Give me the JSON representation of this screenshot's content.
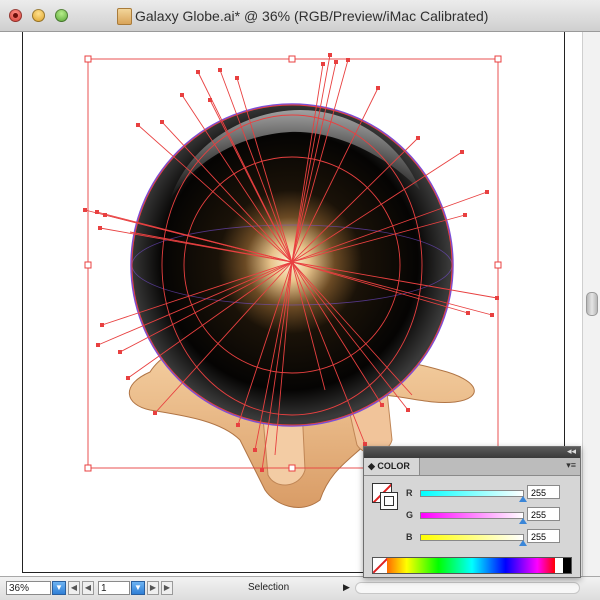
{
  "window": {
    "title": "Galaxy Globe.ai* @ 36% (RGB/Preview/iMac Calibrated)"
  },
  "statusbar": {
    "zoom_value": "36%",
    "page_value": "1",
    "tool_label": "Selection"
  },
  "color_panel": {
    "tab_label": "COLOR",
    "channels": [
      {
        "label": "R",
        "value": "255"
      },
      {
        "label": "G",
        "value": "255"
      },
      {
        "label": "B",
        "value": "255"
      }
    ]
  },
  "colors": {
    "path_red": "#e84040",
    "bounding_purple": "#7a50d8",
    "selection_accent": "#3a86d8"
  },
  "icons": {
    "close": "close-button",
    "minimize": "minimize-button",
    "zoom": "zoom-button",
    "document": "document-icon",
    "panel_menu": "panel-menu-icon"
  }
}
